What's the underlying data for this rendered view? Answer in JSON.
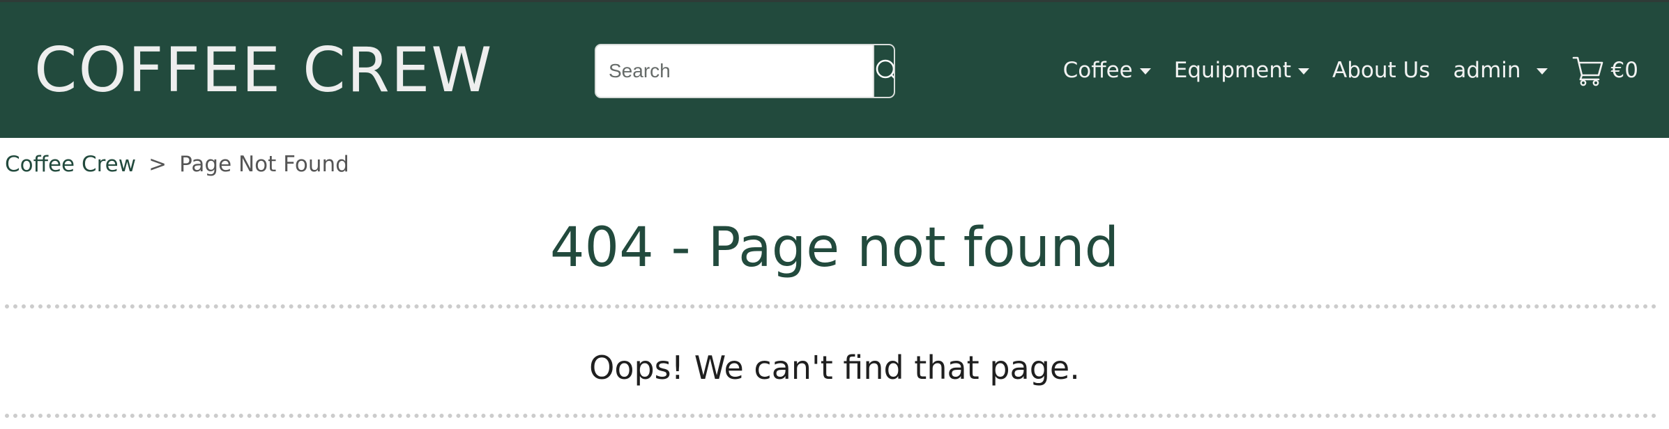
{
  "navbar": {
    "brand": "COFFEE CREW",
    "search": {
      "placeholder": "Search",
      "value": ""
    },
    "menu": {
      "coffee": "Coffee",
      "equipment": "Equipment",
      "about": "About Us",
      "user": "admin",
      "cart_total": "€0"
    }
  },
  "breadcrumb": {
    "home": "Coffee Crew",
    "separator": ">",
    "current": "Page Not Found"
  },
  "main": {
    "title": "404 - Page not found",
    "message": "Oops! We can't find that page."
  },
  "colors": {
    "brand_green": "#224a3d",
    "nav_text": "#f2f2f2",
    "divider": "#cccccc"
  },
  "icons": {
    "search": "search-icon",
    "cart": "cart-icon",
    "dropdown": "chevron-down-icon"
  }
}
